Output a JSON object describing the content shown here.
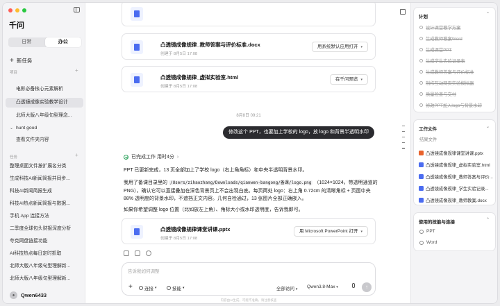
{
  "sidebar": {
    "app_title": "千问",
    "tabs": [
      {
        "label": "日常"
      },
      {
        "label": "办公"
      }
    ],
    "new_task": "新任务",
    "projects_label": "项目",
    "projects": [
      {
        "label": "电影必备核心元素解析"
      },
      {
        "label": "凸透镜成像实验教学设计"
      },
      {
        "label": "北师大版八年级句型理念..."
      },
      {
        "label": "hunt good"
      },
      {
        "label": "查看文件夹内容"
      }
    ],
    "tasks_label": "任务",
    "tasks": [
      {
        "label": "整理桌面文件按扩展名分类"
      },
      {
        "label": "生成科技AI新闻简报并同步..."
      },
      {
        "label": "科技AI新闻简报生成"
      },
      {
        "label": "科技AI热点新闻简报与数据..."
      },
      {
        "label": "手机 App 连接方法"
      },
      {
        "label": "二季度全球包头财报深度分析"
      },
      {
        "label": "夸克网盘链接功能"
      },
      {
        "label": "AI科技热点每日定时抓取"
      },
      {
        "label": "北师大版八年级句型理解新..."
      },
      {
        "label": "北师大版八年级句型理解新..."
      }
    ],
    "user": {
      "name": "Qwen6433"
    }
  },
  "chat": {
    "files_top": [
      {
        "name": "凸透镜成像规律_教师答案与评价标准.docx",
        "meta": "创建于 8月5日 17:08",
        "action": "用系统默认应用打开"
      },
      {
        "name": "凸透镜成像规律_虚拟实验室.html",
        "meta": "创建于 8月5日 17:08",
        "action": "在千问预览"
      }
    ],
    "timestamp": "8月8日 09:21",
    "user_message": "修改这个 PPT，也要加上学校的 logo，放 logo 和背景半透明水印",
    "status": "已完成工作 用时4分",
    "reply": {
      "p1": "PPT 已更新完成，13 页全部加上了学校 logo（右上角角标）和中央半透明背景水印。",
      "p2_before": "我用了备课目录里的",
      "p2_code": "/Users/zihaozhang/Downloads/qianwen-bangong/备课/logo.png",
      "p2_after": "（1024×1024，带透明通道的 PNG），确认它可以直接叠加在深色背景页上不会出现白底。每页两处 logo：右上角 0.72cm 的清晰角标 + 页面中央 88% 透明度的背景水印，不遮挡正文内容。几何自检通过，13 张图片全部正确嵌入。",
      "p3": "如果你希望调整 logo 位置（比如放左上角）、角标大小或水印透明度，告诉我即可。"
    },
    "file_bottom": {
      "name": "凸透镜成像规律课堂讲课.pptx",
      "meta": "创建于 8月5日 17:08",
      "action": "用 Microsoft PowerPoint 打开"
    },
    "composer": {
      "placeholder": "告诉我如何调整",
      "connect": "连接",
      "skills": "技能",
      "access": "全部访问",
      "model": "Qwen3.8-Max"
    },
    "disclaimer": "内容由AI生成，可能不准确，请注意核查"
  },
  "right_panel": {
    "plan_title": "计划",
    "plan_items": [
      "设计课堂教学方案",
      "生成教师教案Word",
      "生成课堂PPT",
      "生成学生实验记录表",
      "生成教师答案与评价标准",
      "制作互动网页实验模拟器",
      "质量检查与交付",
      "修改PPT加入logo与背景水印"
    ],
    "results_title": "工作文件",
    "results_sub": "结果文件",
    "results": [
      {
        "name": "凸透镜成像规律课堂讲课.pptx",
        "color": "#e8622c"
      },
      {
        "name": "凸透镜成像规律_虚拟实验室.html",
        "color": "#4b6cf0"
      },
      {
        "name": "凸透镜成像规律_教师答案与评价...",
        "color": "#4b6cf0"
      },
      {
        "name": "凸透镜成像规律_学生实验记录...",
        "color": "#4b6cf0"
      },
      {
        "name": "凸透镜成像规律_教师教案.docx",
        "color": "#4b6cf0"
      }
    ],
    "tools_title": "使用的技能与连接",
    "tools": [
      "PPT",
      "Word"
    ]
  }
}
